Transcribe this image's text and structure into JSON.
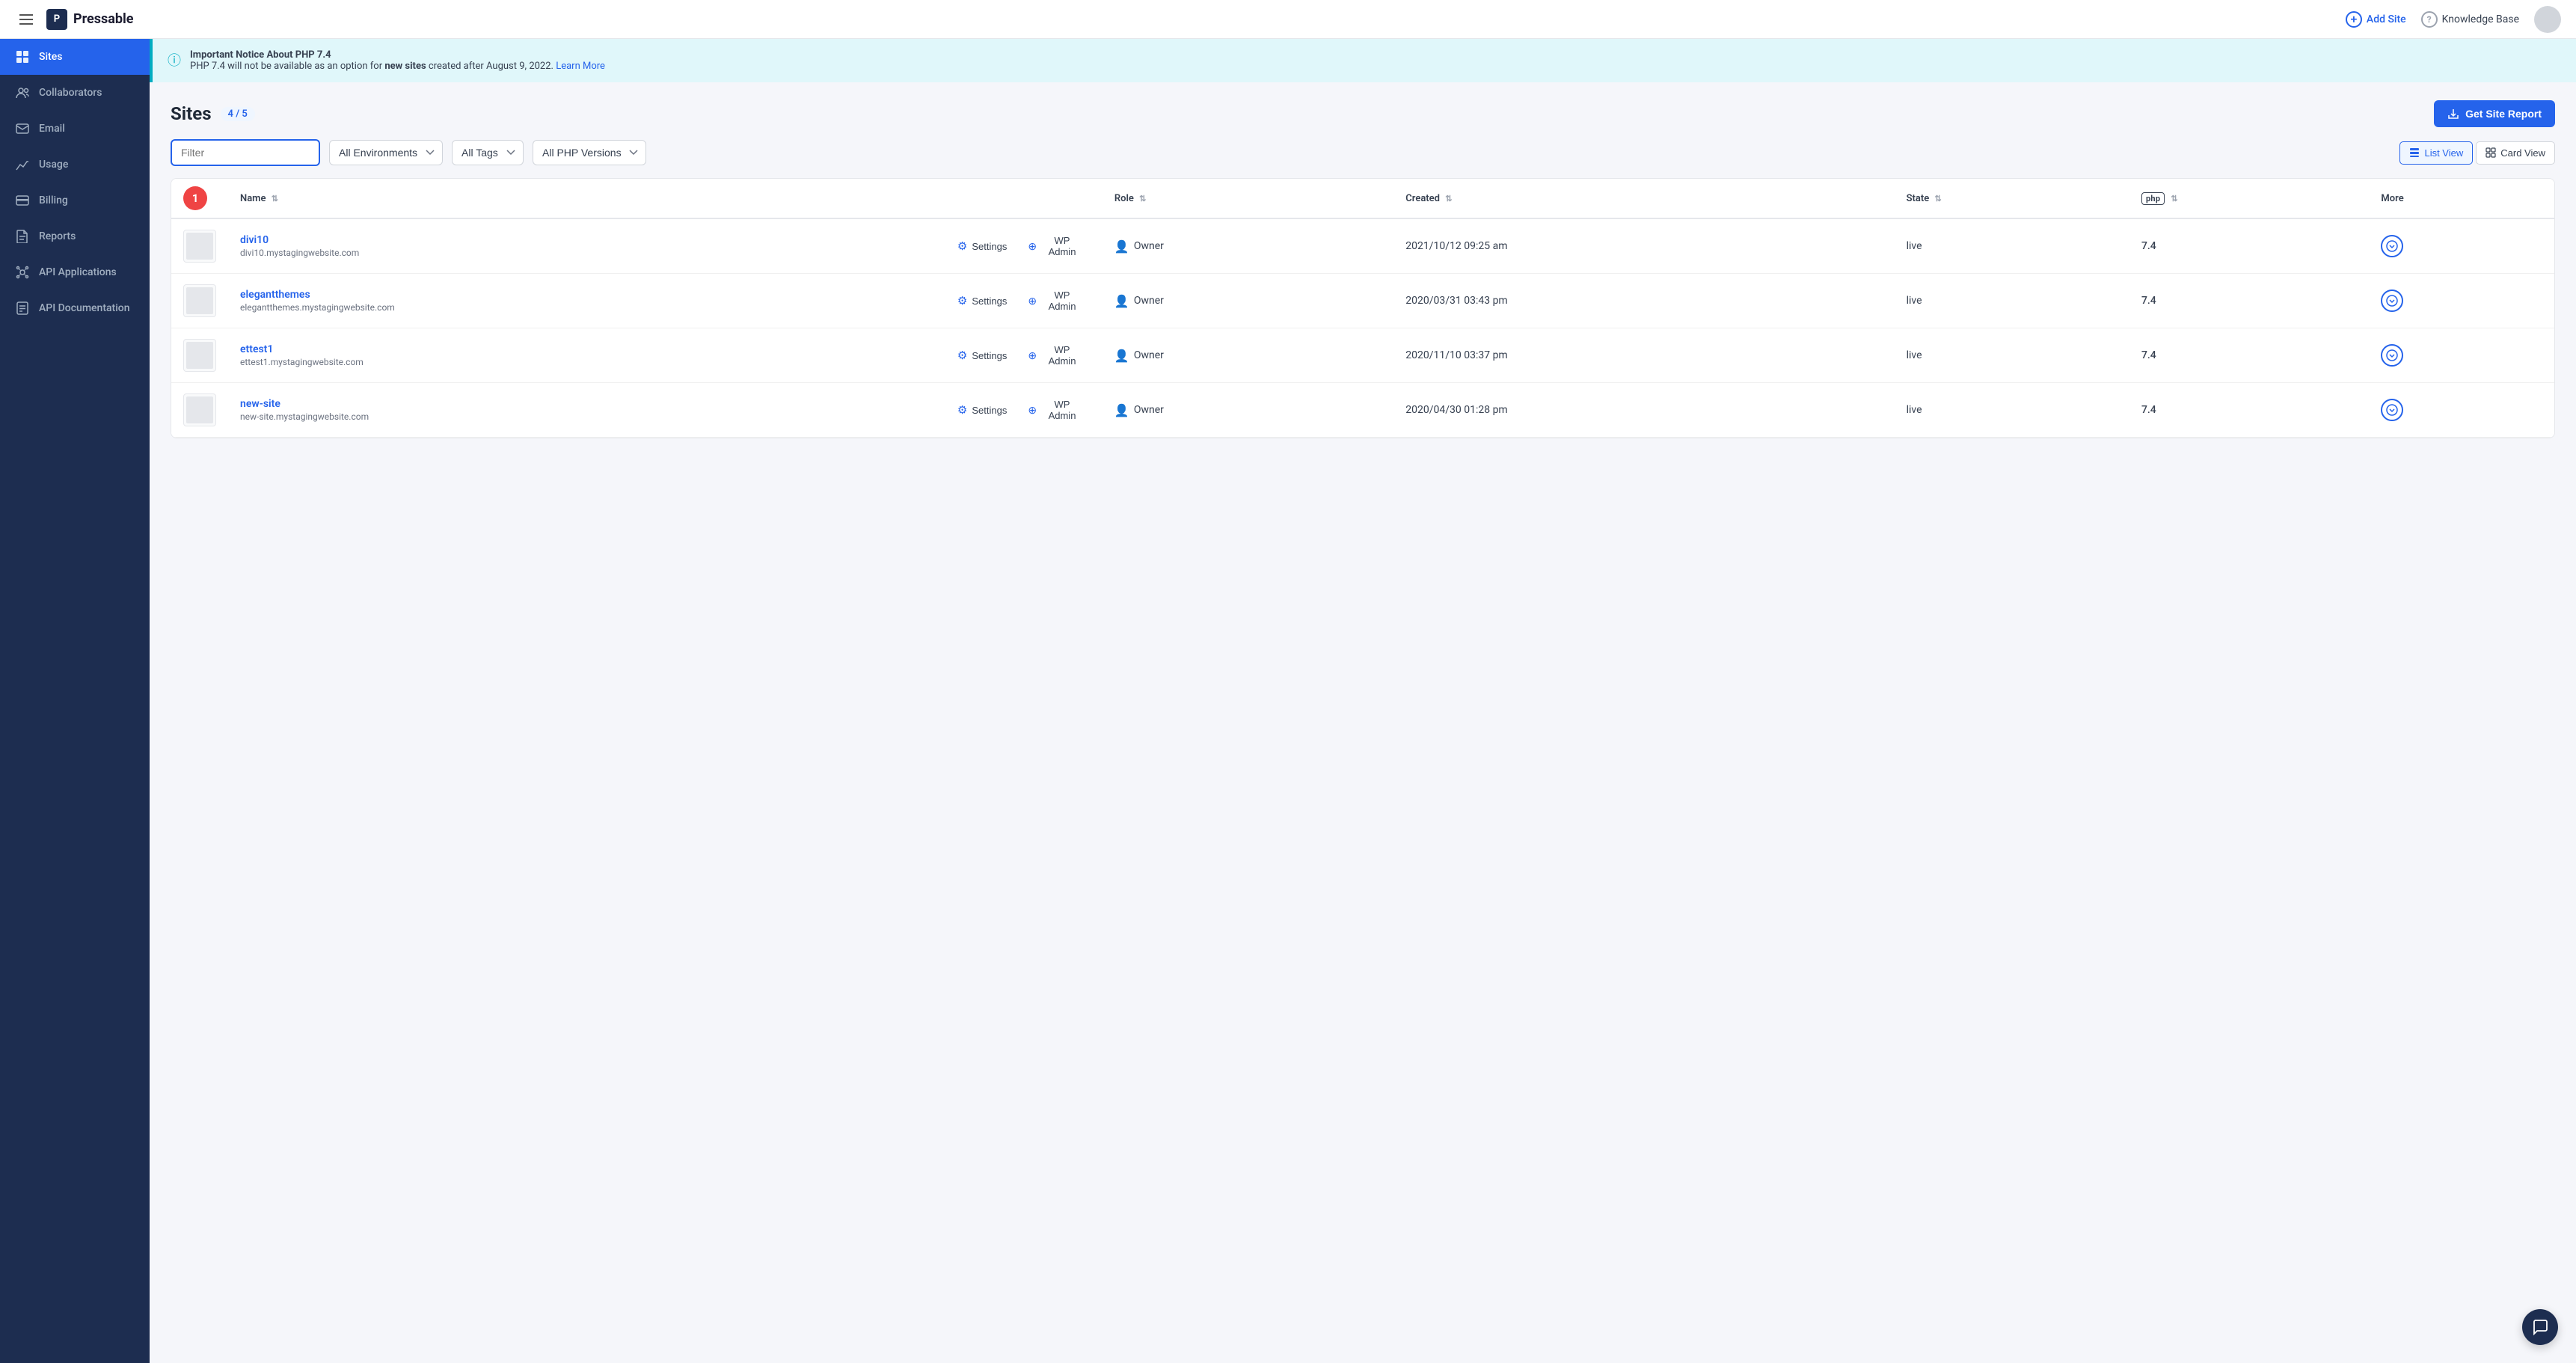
{
  "header": {
    "menu_icon": "hamburger",
    "logo_text": "Pressable",
    "logo_icon_text": "P",
    "add_site_label": "Add Site",
    "knowledge_base_label": "Knowledge Base",
    "avatar_alt": "User Avatar"
  },
  "sidebar": {
    "items": [
      {
        "id": "sites",
        "label": "Sites",
        "icon": "grid",
        "active": true
      },
      {
        "id": "collaborators",
        "label": "Collaborators",
        "icon": "users"
      },
      {
        "id": "email",
        "label": "Email",
        "icon": "mail"
      },
      {
        "id": "usage",
        "label": "Usage",
        "icon": "chart"
      },
      {
        "id": "billing",
        "label": "Billing",
        "icon": "card"
      },
      {
        "id": "reports",
        "label": "Reports",
        "icon": "file"
      },
      {
        "id": "api-applications",
        "label": "API Applications",
        "icon": "api"
      },
      {
        "id": "api-documentation",
        "label": "API Documentation",
        "icon": "doc"
      }
    ]
  },
  "notice": {
    "title": "Important Notice About PHP 7.4",
    "text": "PHP 7.4 will not be available as an option for ",
    "bold_text": "new sites",
    "text2": " created after August 9, 2022.",
    "link_text": "Learn More",
    "link_href": "#"
  },
  "sites_section": {
    "title": "Sites",
    "count": "4 / 5",
    "get_report_label": "Get Site Report",
    "filter_placeholder": "Filter",
    "environments_label": "All Environments",
    "tags_label": "All Tags",
    "php_versions_label": "All PHP Versions",
    "list_view_label": "List View",
    "card_view_label": "Card View"
  },
  "table": {
    "columns": {
      "name": "Name",
      "role": "Role",
      "created": "Created",
      "state": "State",
      "php": "PHP",
      "more": "More"
    },
    "selected_count": 1,
    "rows": [
      {
        "id": "divi10",
        "name": "divi10",
        "url": "divi10.mystagingwebsite.com",
        "role": "Owner",
        "created": "2021/10/12 09:25 am",
        "state": "live",
        "php": "7.4"
      },
      {
        "id": "elegantthemes",
        "name": "elegantthemes",
        "url": "elegantthemes.mystagingwebsite.com",
        "role": "Owner",
        "created": "2020/03/31 03:43 pm",
        "state": "live",
        "php": "7.4"
      },
      {
        "id": "ettest1",
        "name": "ettest1",
        "url": "ettest1.mystagingwebsite.com",
        "role": "Owner",
        "created": "2020/11/10 03:37 pm",
        "state": "live",
        "php": "7.4"
      },
      {
        "id": "new-site",
        "name": "new-site",
        "url": "new-site.mystagingwebsite.com",
        "role": "Owner",
        "created": "2020/04/30 01:28 pm",
        "state": "live",
        "php": "7.4"
      }
    ],
    "actions": {
      "settings": "Settings",
      "wp_admin": "WP Admin"
    }
  }
}
